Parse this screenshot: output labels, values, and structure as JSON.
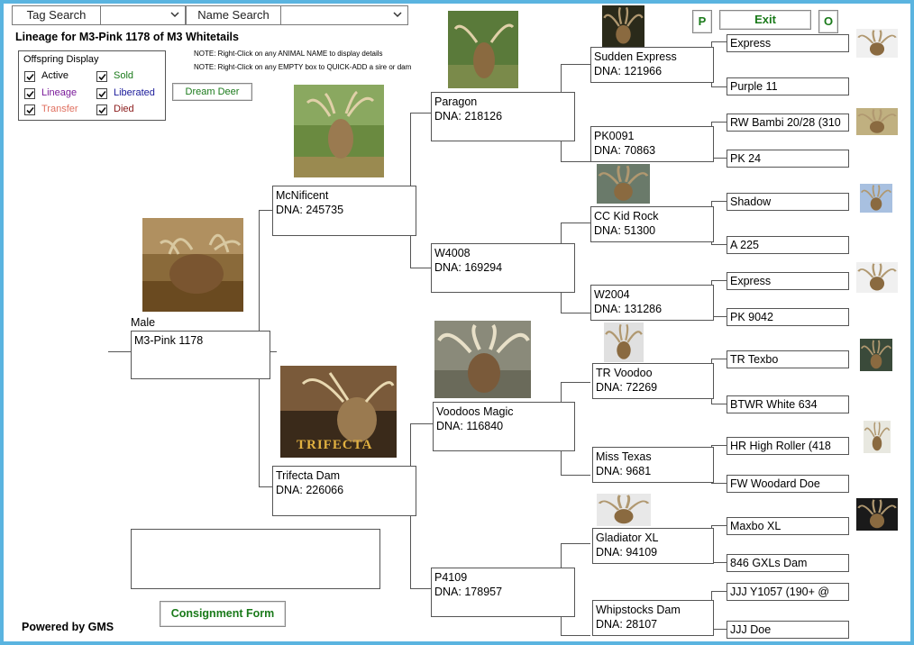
{
  "search": {
    "tag_label": "Tag Search",
    "name_label": "Name Search",
    "tag_value": "",
    "name_value": ""
  },
  "header": {
    "title": "Lineage for M3-Pink 1178 of M3 Whitetails",
    "note1": "NOTE: Right-Click on any ANIMAL NAME to display details",
    "note2": "NOTE: Right-Click on any EMPTY box to QUICK-ADD a sire or dam"
  },
  "buttons": {
    "p": "P",
    "exit": "Exit",
    "o": "O",
    "dream": "Dream Deer",
    "consignment": "Consignment Form"
  },
  "legend": {
    "title": "Offspring Display",
    "items": [
      {
        "label": "Active",
        "color": "#000000"
      },
      {
        "label": "Sold",
        "color": "#1a7a1a"
      },
      {
        "label": "Lineage",
        "color": "#7a1a9a"
      },
      {
        "label": "Liberated",
        "color": "#1a1a9a"
      },
      {
        "label": "Transfer",
        "color": "#e07060"
      },
      {
        "label": "Died",
        "color": "#8a1a1a"
      }
    ]
  },
  "footer": {
    "powered": "Powered by GMS"
  },
  "subject": {
    "sex": "Male",
    "name": "M3-Pink 1178"
  },
  "gen1": {
    "sire": {
      "name": "McNificent",
      "dna": "DNA:  245735"
    },
    "dam": {
      "name": "Trifecta Dam",
      "dna": "DNA:  226066"
    }
  },
  "gen2": [
    {
      "name": "Paragon",
      "dna": "DNA: 218126"
    },
    {
      "name": "W4008",
      "dna": "DNA:  169294"
    },
    {
      "name": "Voodoos Magic",
      "dna": "DNA:  116840"
    },
    {
      "name": "P4109",
      "dna": "DNA:  178957"
    }
  ],
  "gen3": [
    {
      "name": "Sudden Express",
      "dna": "DNA:  121966"
    },
    {
      "name": "PK0091",
      "dna": "DNA:  70863"
    },
    {
      "name": "CC Kid Rock",
      "dna": "DNA:  51300"
    },
    {
      "name": "W2004",
      "dna": "DNA:  131286"
    },
    {
      "name": "TR Voodoo",
      "dna": "DNA:  72269"
    },
    {
      "name": "Miss Texas",
      "dna": "DNA:  9681"
    },
    {
      "name": "Gladiator XL",
      "dna": "DNA:  94109"
    },
    {
      "name": "Whipstocks Dam",
      "dna": "DNA:  28107"
    }
  ],
  "gen4": [
    "Express",
    "Purple 11",
    "RW Bambi 20/28 (310",
    "PK 24",
    "Shadow",
    "A 225",
    "Express",
    "PK 9042",
    "TR Texbo",
    "BTWR White 634",
    "HR High Roller (418",
    "FW Woodard Doe",
    "Maxbo XL",
    "846 GXLs Dam",
    "JJJ Y1057 (190+ @",
    "JJJ Doe"
  ],
  "photo_caption_trifecta": "TRIFECTA"
}
